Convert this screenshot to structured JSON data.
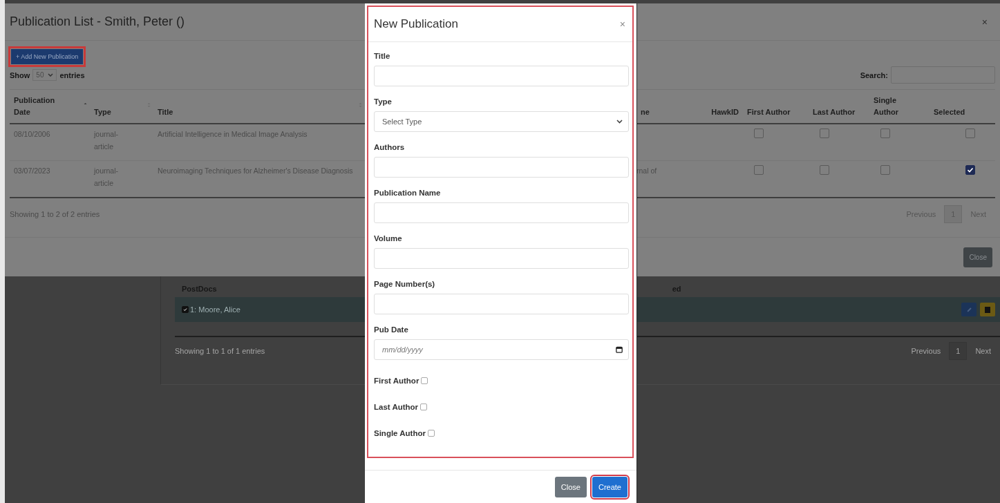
{
  "background_page": {
    "section_label": "PostDocs",
    "column_fragment": "ed",
    "rows": [
      {
        "checked": true,
        "label": "1: Moore, Alice"
      }
    ],
    "info": "Showing 1 to 1 of 1 entries",
    "pagination": {
      "previous": "Previous",
      "page": "1",
      "next": "Next"
    }
  },
  "publication_list": {
    "title": "Publication List - Smith, Peter ()",
    "close": "×",
    "add_button": "+ Add New Publication",
    "length": {
      "before": "Show",
      "value": "50",
      "after": "entries"
    },
    "search": {
      "label": "Search:"
    },
    "table": {
      "columns": [
        "Publication Date",
        "Type",
        "Title",
        "ne",
        "HawkID",
        "First Author",
        "Last Author",
        "Single Author",
        "Selected"
      ],
      "rows": [
        {
          "publication_date": "08/10/2006",
          "type": "journal-article",
          "title": "Artificial Intelligence in Medical Image Analysis",
          "first_author": false,
          "last_author": false,
          "single_author": false,
          "selected": false
        },
        {
          "publication_date": "03/07/2023",
          "type": "journal-article",
          "title": "Neuroimaging Techniques for Alzheimer's Disease Diagnosis",
          "column_5": "rnal of",
          "first_author": false,
          "last_author": false,
          "single_author": false,
          "selected": true
        }
      ]
    },
    "info": "Showing 1 to 2 of 2 entries",
    "pagination": {
      "previous": "Previous",
      "page": "1",
      "next": "Next"
    },
    "footer_button": "Close"
  },
  "new_publication": {
    "title": "New Publication",
    "close": "×",
    "fields": [
      {
        "kind": "text",
        "label": "Title"
      },
      {
        "kind": "select",
        "label": "Type",
        "value": "Select Type"
      },
      {
        "kind": "text",
        "label": "Authors"
      },
      {
        "kind": "text",
        "label": "Publication Name"
      },
      {
        "kind": "text",
        "label": "Volume"
      },
      {
        "kind": "text",
        "label": "Page Number(s)"
      },
      {
        "kind": "date",
        "label": "Pub Date",
        "placeholder": "mm/dd/yyyy"
      },
      {
        "kind": "checkbox",
        "label": "First Author",
        "checked": false
      },
      {
        "kind": "checkbox",
        "label": "Last Author",
        "checked": false
      },
      {
        "kind": "checkbox",
        "label": "Single Author",
        "checked": false
      }
    ],
    "buttons": [
      {
        "kind": "secondary",
        "label": "Close"
      },
      {
        "kind": "primary",
        "label": "Create"
      }
    ]
  }
}
